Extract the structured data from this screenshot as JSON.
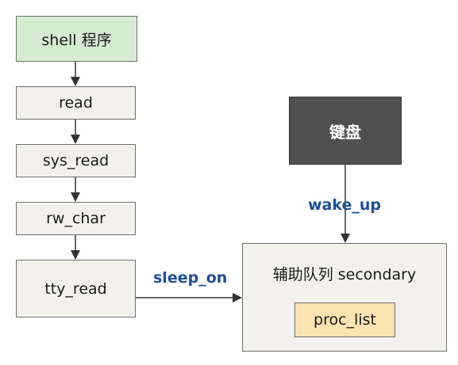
{
  "diagram": {
    "nodes": {
      "shell": {
        "label": "shell 程序"
      },
      "read": {
        "label": "read"
      },
      "sys_read": {
        "label": "sys_read"
      },
      "rw_char": {
        "label": "rw_char"
      },
      "tty_read": {
        "label": "tty_read"
      },
      "keyboard": {
        "label": "键盘"
      },
      "secondary": {
        "label": "辅助队列 secondary"
      },
      "proc_list": {
        "label": "proc_list"
      }
    },
    "edges": [
      {
        "from": "shell",
        "to": "read",
        "label": ""
      },
      {
        "from": "read",
        "to": "sys_read",
        "label": ""
      },
      {
        "from": "sys_read",
        "to": "rw_char",
        "label": ""
      },
      {
        "from": "rw_char",
        "to": "tty_read",
        "label": ""
      },
      {
        "from": "tty_read",
        "to": "secondary",
        "label": "sleep_on"
      },
      {
        "from": "keyboard",
        "to": "secondary",
        "label": "wake_up"
      }
    ],
    "colors": {
      "start_fill": "#d5ecd2",
      "step_fill": "#f2f1ee",
      "keyboard_fill": "#505050",
      "list_fill": "#fde3b1",
      "label_color": "#1f4e99",
      "line_color": "#333333"
    }
  }
}
